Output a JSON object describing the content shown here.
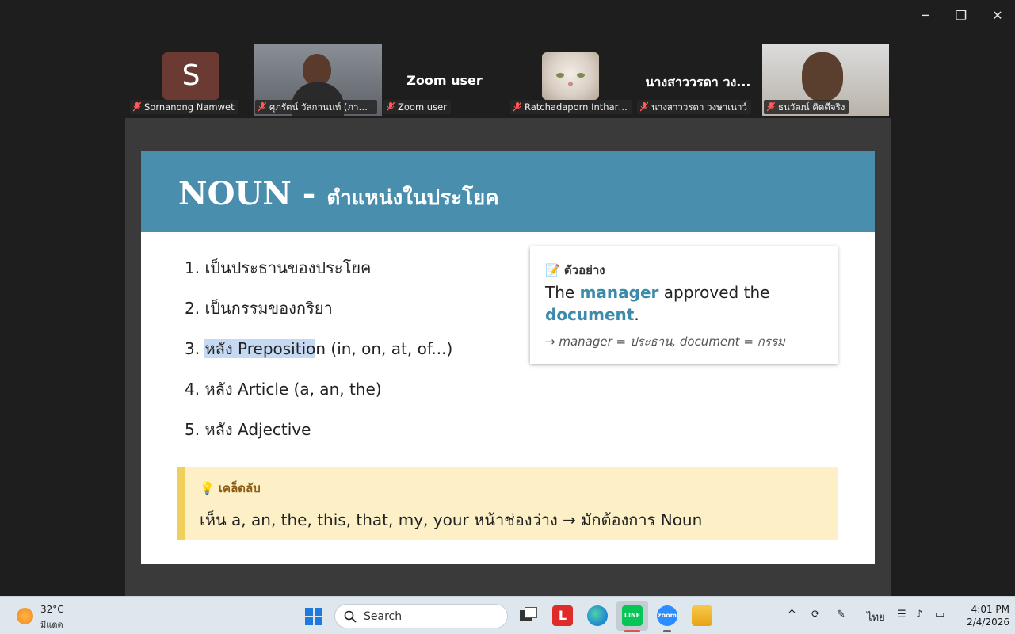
{
  "window": {
    "minimize_glyph": "─",
    "restore_glyph": "❐",
    "close_glyph": "✕"
  },
  "participants": [
    {
      "name": "Sornanong Namwet",
      "avatar_letter": "S",
      "muted": true
    },
    {
      "name": "ศุภรัตน์ วัลกานนท์ (ภาษาศาส...",
      "muted": true,
      "active_speaker": true
    },
    {
      "name": "Zoom user",
      "display": "Zoom user",
      "muted": true
    },
    {
      "name": "Ratchadaporn Inthara...",
      "muted": true
    },
    {
      "name": "นางสาววรดา วงษาเนาว์",
      "display": "นางสาววรดา วง...",
      "muted": true
    },
    {
      "name": "ธนวัฒน์ คิดดีจริง",
      "muted": true
    }
  ],
  "slide": {
    "title_main": "NOUN",
    "title_sep": " - ",
    "title_thai": "ตำแหน่งในประโยค",
    "items": [
      {
        "num": "1.",
        "text": "เป็นประธานของประโยค"
      },
      {
        "num": "2.",
        "text": "เป็นกรรมของกริยา"
      },
      {
        "num": "3.",
        "text_highlight": "หลัง Prepositio",
        "text_rest": "n (in, on, at, of...)"
      },
      {
        "num": "4.",
        "text": "หลัง Article (a, an, the)"
      },
      {
        "num": "5.",
        "text": "หลัง Adjective"
      }
    ],
    "example": {
      "label": "ตัวอย่าง",
      "sentence_a": "The ",
      "kw1": "manager",
      "sentence_b": " approved the ",
      "kw2": "document",
      "sentence_c": ".",
      "note": "→ manager = ประธาน, document = กรรม"
    },
    "tip": {
      "label": "เคล็ดลับ",
      "text": "เห็น a, an, the, this, that, my, your หน้าช่องว่าง → มักต้องการ Noun"
    }
  },
  "taskbar": {
    "weather_temp": "32°C",
    "weather_cond": "มีแดด",
    "search_placeholder": "Search",
    "language": "ไทย",
    "time": "4:01 PM",
    "date": "2/4/2026",
    "colors": {
      "line": "#06c755",
      "zoom": "#2d8cff",
      "l_app": "#e02b2b"
    }
  }
}
